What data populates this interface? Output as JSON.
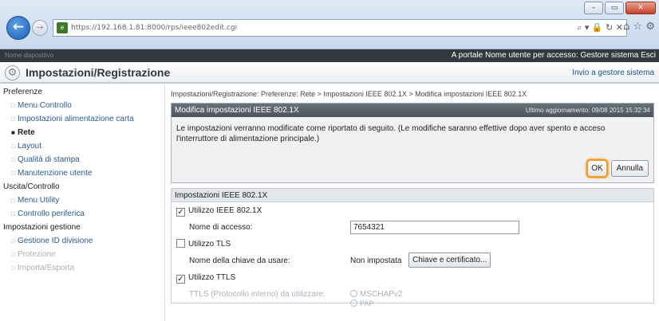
{
  "browser": {
    "url": "https://192.168.1.81:8000/rps/ieee802edit.cgi",
    "window_buttons": [
      "–",
      "▭",
      "✕"
    ],
    "address_icons": "⌕ ▾ 🔒 ↻ ✕",
    "toolbar_icons": "⌂ ☆ ⚙"
  },
  "topbar": {
    "left_text": "Nome dispositivo",
    "right_text": "A portale   Nome utente per accesso: Gestore sistema Esci"
  },
  "header": {
    "title": "Impostazioni/Registrazione",
    "link": "Invio a gestore sistema"
  },
  "sidebar": {
    "sections": [
      {
        "title": "Preferenze",
        "items": [
          {
            "label": "Menu Controllo",
            "active": false
          },
          {
            "label": "Impostazioni alimentazione carta",
            "active": false
          },
          {
            "label": "Rete",
            "active": true
          },
          {
            "label": "Layout",
            "active": false
          },
          {
            "label": "Qualità di stampa",
            "active": false
          },
          {
            "label": "Manutenzione utente",
            "active": false
          }
        ]
      },
      {
        "title": "Uscita/Controllo",
        "items": [
          {
            "label": "Menu Utility",
            "active": false
          },
          {
            "label": "Controllo periferica",
            "active": false
          }
        ]
      },
      {
        "title": "Impostazioni gestione",
        "items": [
          {
            "label": "Gestione ID divisione",
            "active": false
          },
          {
            "label": "Protezione",
            "active": false
          },
          {
            "label": "Importa/Esporta",
            "active": false
          }
        ]
      }
    ]
  },
  "main": {
    "breadcrumb": "Impostazioni/Registrazione: Preferenze: Rete > Impostazioni IEEE 802.1X > Modifica impostazioni IEEE 802.1X",
    "panel": {
      "title": "Modifica impostazioni IEEE 802.1X",
      "updated": "Ultimo aggiornamento: 09/08 2015 15:32:34",
      "message": "Le impostazioni verranno modificate come riportato di seguito. (Le modifiche saranno effettive dopo aver spento e acceso l'interruttore di alimentazione principale.)",
      "ok_label": "OK",
      "cancel_label": "Annulla"
    },
    "settings": {
      "title": "Impostazioni IEEE 802.1X",
      "use_ieee": {
        "label": "Utilizzo IEEE 802.1X",
        "checked": true
      },
      "login_name_label": "Nome di accesso:",
      "login_name_value": "7654321",
      "use_tls": {
        "label": "Utilizzo TLS",
        "checked": false
      },
      "key_name_label": "Nome della chiave da usare:",
      "key_name_value": "Non impostata",
      "key_button": "Chiave e certificato...",
      "use_ttls": {
        "label": "Utilizzo TTLS",
        "checked": true
      },
      "ttls_label": "TTLS (Protocollo interno) da utilizzare:",
      "ttls_options": [
        "MSCHAPv2",
        "PAP"
      ]
    }
  }
}
